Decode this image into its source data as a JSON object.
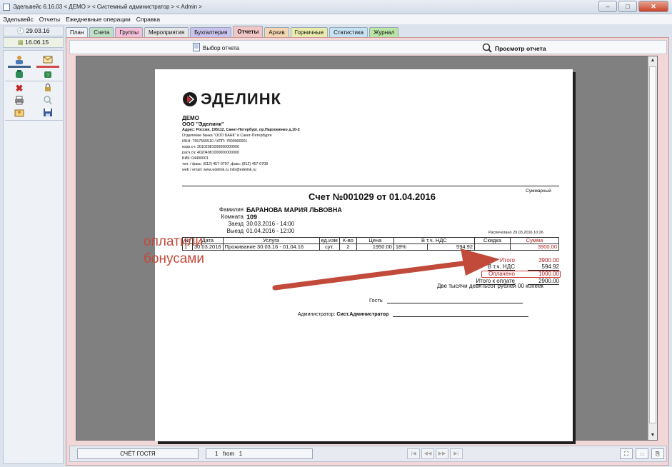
{
  "window": {
    "title": "Эдельвейс 6.16.03 < ДЕМО > < Системный администратор > < Admin >",
    "buttons": [
      "minimize",
      "maximize",
      "close"
    ]
  },
  "menu": [
    "Эдельвейс",
    "Отчеты",
    "Ежедневные операции",
    "Справка"
  ],
  "dates": {
    "current": "29.03.16",
    "secondary": "16.06.15"
  },
  "tabs": [
    {
      "label": "План",
      "color": "#eef1f5"
    },
    {
      "label": "Счета",
      "color": "#bfe0c7"
    },
    {
      "label": "Группы",
      "color": "#f2c0d8"
    },
    {
      "label": "Мероприятия",
      "color": "#e6e6e6"
    },
    {
      "label": "Бухгалтерия",
      "color": "#c9c3ee"
    },
    {
      "label": "Отчеты",
      "color": "#f2c6c6",
      "active": true
    },
    {
      "label": "Архив",
      "color": "#f4d7b0"
    },
    {
      "label": "Горничные",
      "color": "#e9ecaa"
    },
    {
      "label": "Статистика",
      "color": "#c8e2f5"
    },
    {
      "label": "Журнал",
      "color": "#b9e6a6"
    }
  ],
  "toolbar": {
    "select_report": "Выбор отчета",
    "view_report": "Просмотр отчета"
  },
  "report": {
    "logo_text": "ЭДЕЛИНК",
    "org": {
      "demo": "ДЕМО",
      "name": "ООО \"Эделинк\"",
      "address": "Адрес: Россия, 195112, Санкт-Петербург, пр.Пархоменко д.10-2",
      "bank": "Отделение банка \"ООО БАНК\" в Санкт-Петербурге",
      "inn": "ИНН: 7557555510 / КПП: 7800000001",
      "korr": "корр.сч: 30102081000000000000",
      "rasch": "расч.сч: 40204081000000000000",
      "bik": "БИК: 04400001",
      "tel": "тел. / факс: (812) 457-0707 ,факс: (812) 457-0708",
      "web": "web / email: www.edelink.ru info@edelink.ru"
    },
    "invoice_title": "Счет №001029 от 01.04.2016",
    "invoice_type": "Суммарный",
    "guest": {
      "surname_label": "Фамилия",
      "surname": "БАРАНОВА МАРИЯ ЛЬВОВНА",
      "room_label": "Комната",
      "room": "109",
      "checkin_label": "Заезд",
      "checkin": "30.03.2016 - 14:00",
      "checkout_label": "Выезд",
      "checkout": "01.04.2016 - 12:00"
    },
    "printed": "Распечатано 29.03.2016 10:26",
    "table": {
      "headers": [
        "№",
        "Дата",
        "Услуга",
        "ед.изм",
        "К-во",
        "Цена",
        "В т.ч. НДС",
        "Скидка",
        "Сумма"
      ],
      "rows": [
        [
          "1",
          "30.03.2016",
          "Проживание 30.03.16 - 01.04.16",
          "сут.",
          "2",
          "1950.00",
          "18%",
          "594.92",
          "",
          "3900.00"
        ]
      ]
    },
    "totals": {
      "total_label": "Итого",
      "total": "3900.00",
      "vat_label": "В т.ч. НДС",
      "vat": "594.92",
      "paid_label": "Оплачено",
      "paid": "1000.00",
      "due_label": "Итого к оплате",
      "due": "2900.00"
    },
    "amount_words": "Две тысячи девятьсот рублей 00 копеек",
    "guest_sign_label": "Гость",
    "admin_sign_label": "Администратор:",
    "admin_name": "Сист.Администратор"
  },
  "annotation": {
    "line1": "оплатили",
    "line2": "бонусами",
    "color": "#c24a3a"
  },
  "statusbar": {
    "report_name": "СЧЁТ ГОСТЯ",
    "page": "1",
    "from_label": "from",
    "total_pages": "1"
  },
  "icons": [
    "user-icon",
    "envelope-icon",
    "phone-icon",
    "phone-alt-icon",
    "delete-icon",
    "lock-icon",
    "print-icon",
    "search-icon",
    "edit-icon",
    "save-icon"
  ]
}
